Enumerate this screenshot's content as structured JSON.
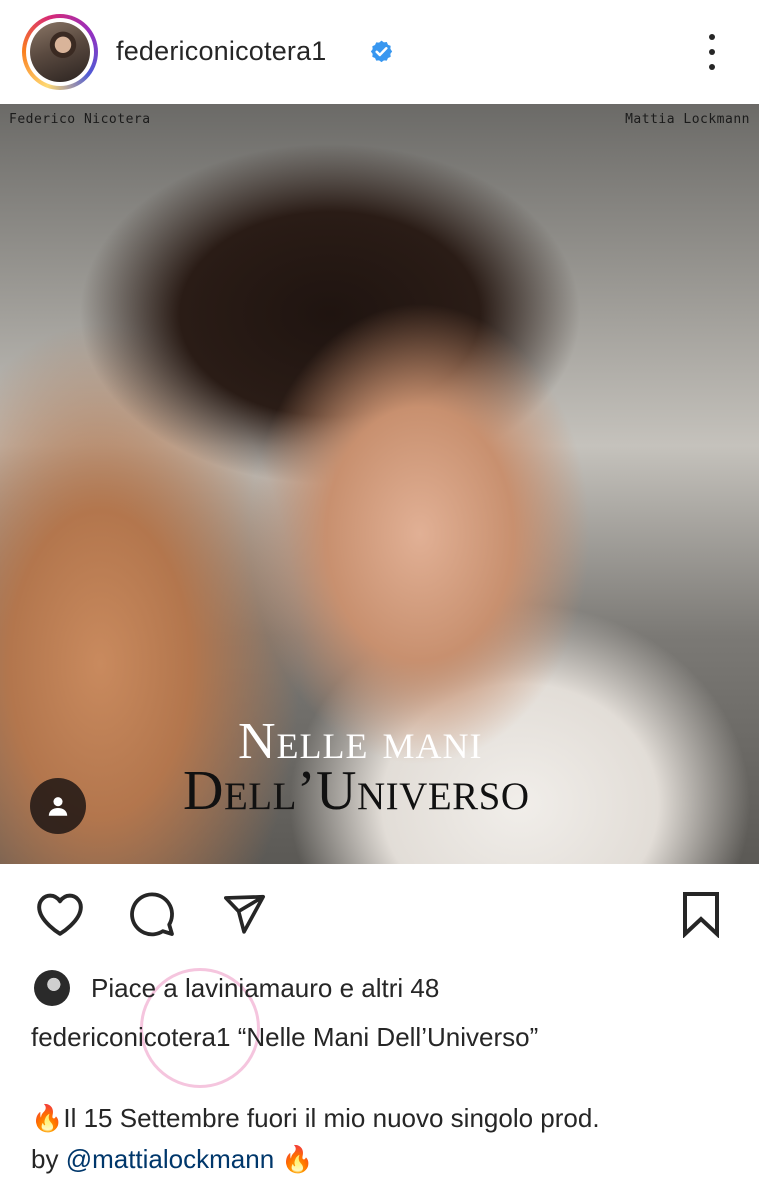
{
  "header": {
    "username": "federiconicotera1",
    "verified": true,
    "icons": {
      "verified": "verified-badge-icon",
      "more": "more-vertical-icon"
    },
    "accent_color": "#3897f0"
  },
  "post": {
    "credit_left": "Federico Nicotera",
    "credit_right": "Mattia Lockmann",
    "title_line1": "Nelle mani",
    "title_line2": "Dell’Universo",
    "tag_icon": "user-tag-icon"
  },
  "actions": {
    "icons": [
      "heart-icon",
      "comment-icon",
      "share-icon",
      "bookmark-icon"
    ]
  },
  "likes": {
    "text": "Piace a laviniamauro e altri 48"
  },
  "caption": {
    "username": "federiconicotera1",
    "title": "“Nelle Mani Dell’Universo”",
    "body_line1": "🔥Il 15 Settembre fuori il mio nuovo singolo prod.",
    "body_prefix": "by ",
    "mention": "@mattialockmann",
    "body_suffix": " 🔥",
    "mention_color": "#00376b"
  }
}
